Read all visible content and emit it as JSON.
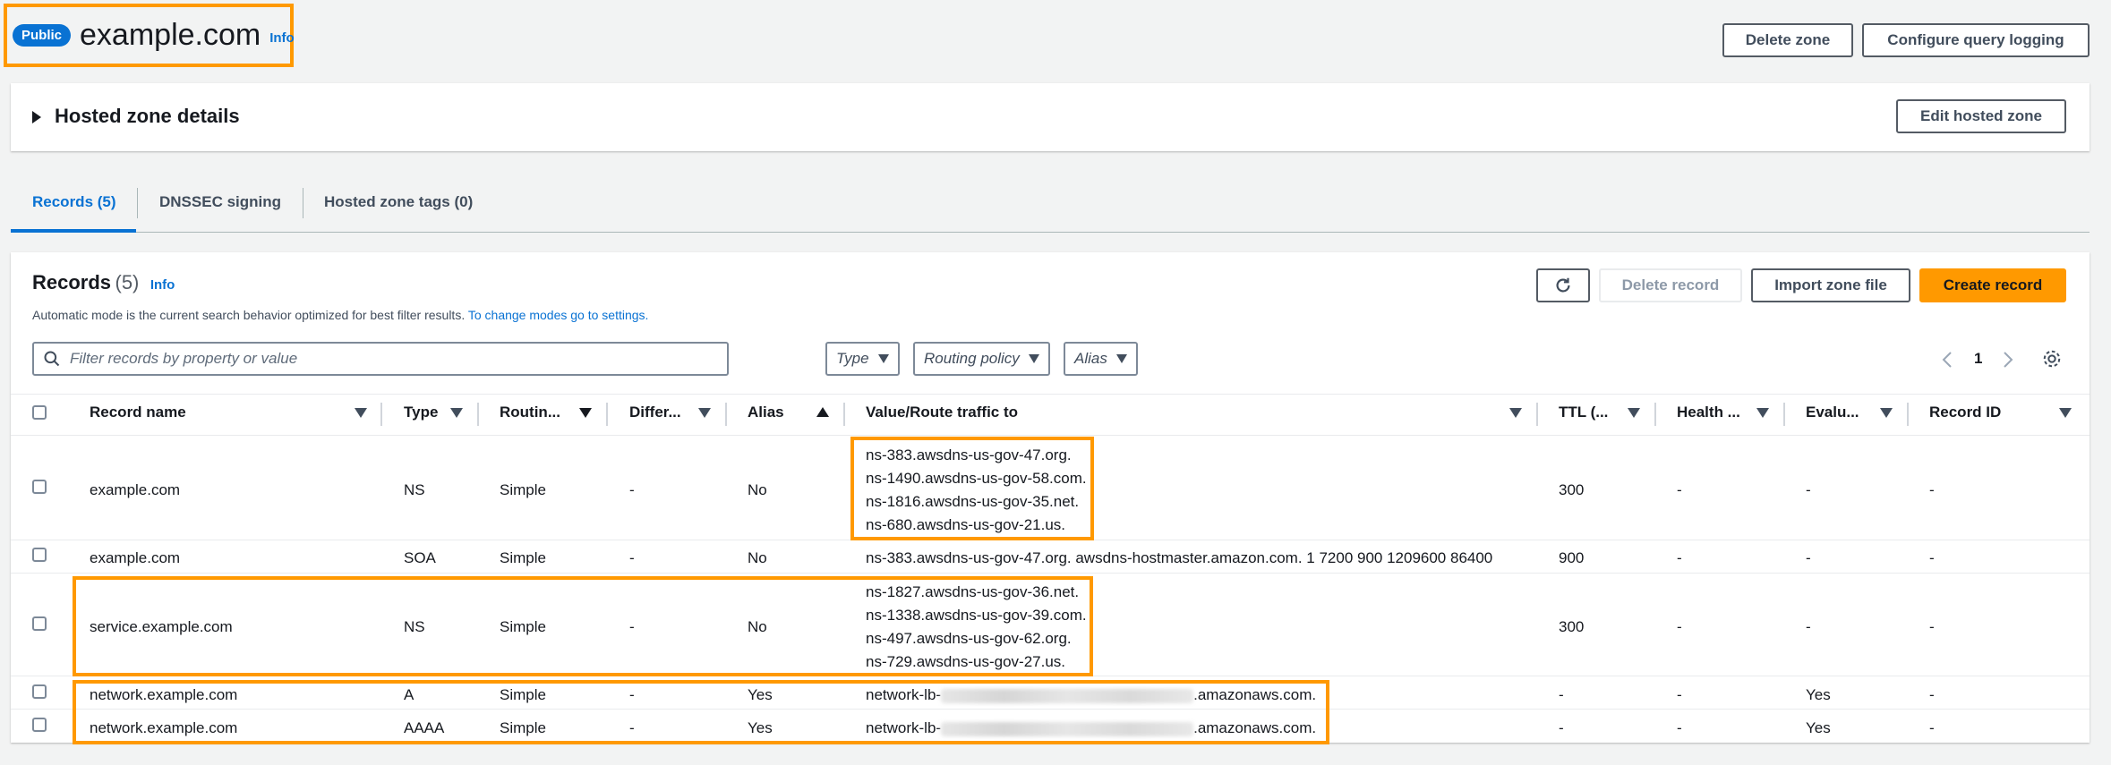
{
  "header": {
    "badge": "Public",
    "title": "example.com",
    "info": "Info",
    "delete_zone": "Delete zone",
    "configure_logging": "Configure query logging"
  },
  "details": {
    "title": "Hosted zone details",
    "edit": "Edit hosted zone"
  },
  "tabs": [
    {
      "label": "Records (5)"
    },
    {
      "label": "DNSSEC signing"
    },
    {
      "label": "Hosted zone tags (0)"
    }
  ],
  "records": {
    "title": "Records",
    "count": "(5)",
    "info": "Info",
    "description": "Automatic mode is the current search behavior optimized for best filter results.",
    "settings_link": "To change modes go to settings.",
    "delete_record": "Delete record",
    "import_zone": "Import zone file",
    "create_record": "Create record",
    "search_placeholder": "Filter records by property or value",
    "filters": {
      "type": "Type",
      "routing": "Routing policy",
      "alias": "Alias"
    },
    "page": "1"
  },
  "columns": [
    "Record name",
    "Type",
    "Routin...",
    "Differ...",
    "Alias",
    "Value/Route traffic to",
    "TTL (...",
    "Health ...",
    "Evalu...",
    "Record ID"
  ],
  "rows": [
    {
      "name": "example.com",
      "type": "NS",
      "routing": "Simple",
      "differ": "-",
      "alias": "No",
      "values": [
        "ns-383.awsdns-us-gov-47.org.",
        "ns-1490.awsdns-us-gov-58.com.",
        "ns-1816.awsdns-us-gov-35.net.",
        "ns-680.awsdns-us-gov-21.us."
      ],
      "ttl": "300",
      "health": "-",
      "evaluate": "-",
      "record_id": "-"
    },
    {
      "name": "example.com",
      "type": "SOA",
      "routing": "Simple",
      "differ": "-",
      "alias": "No",
      "values": [
        "ns-383.awsdns-us-gov-47.org. awsdns-hostmaster.amazon.com. 1 7200 900 1209600 86400"
      ],
      "ttl": "900",
      "health": "-",
      "evaluate": "-",
      "record_id": "-"
    },
    {
      "name": "service.example.com",
      "type": "NS",
      "routing": "Simple",
      "differ": "-",
      "alias": "No",
      "values": [
        "ns-1827.awsdns-us-gov-36.net.",
        "ns-1338.awsdns-us-gov-39.com.",
        "ns-497.awsdns-us-gov-62.org.",
        "ns-729.awsdns-us-gov-27.us."
      ],
      "ttl": "300",
      "health": "-",
      "evaluate": "-",
      "record_id": "-"
    },
    {
      "name": "network.example.com",
      "type": "A",
      "routing": "Simple",
      "differ": "-",
      "alias": "Yes",
      "value_prefix": "network-lb-",
      "value_suffix": ".amazonaws.com.",
      "ttl": "-",
      "health": "-",
      "evaluate": "Yes",
      "record_id": "-"
    },
    {
      "name": "network.example.com",
      "type": "AAAA",
      "routing": "Simple",
      "differ": "-",
      "alias": "Yes",
      "value_prefix": "network-lb-",
      "value_suffix": ".amazonaws.com.",
      "ttl": "-",
      "health": "-",
      "evaluate": "Yes",
      "record_id": "-"
    }
  ],
  "colors": {
    "accent": "#0972d3",
    "primary": "#ff9900",
    "highlight": "#ff9900"
  }
}
